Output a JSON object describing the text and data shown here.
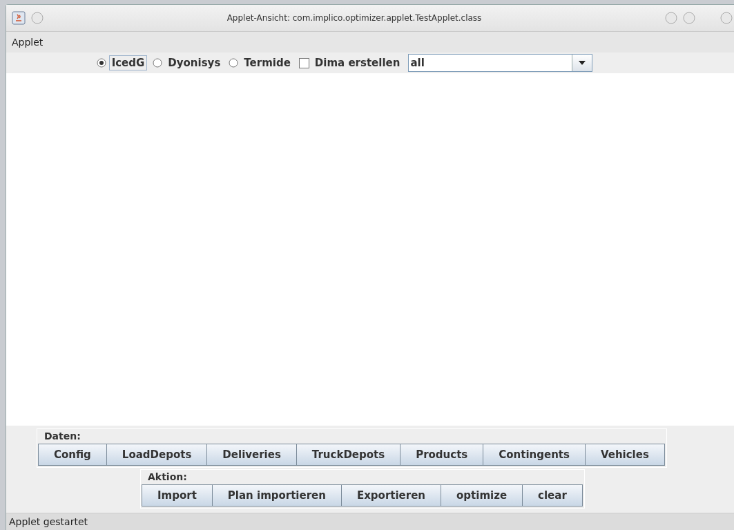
{
  "window": {
    "title": "Applet-Ansicht: com.implico.optimizer.applet.TestApplet.class"
  },
  "menu": [
    "Applet"
  ],
  "options": [
    {
      "kind": "radio",
      "label": "IcedG",
      "selected": true,
      "focused": true
    },
    {
      "kind": "radio",
      "label": "Dyonisys",
      "selected": false,
      "focused": false
    },
    {
      "kind": "radio",
      "label": "Termide",
      "selected": false,
      "focused": false
    },
    {
      "kind": "checkbox",
      "label": "Dima erstellen",
      "checked": false,
      "focused": false
    }
  ],
  "combo": {
    "value": "all"
  },
  "groups": [
    {
      "title": "Daten:",
      "buttons": [
        "Config",
        "LoadDepots",
        "Deliveries",
        "TruckDepots",
        "Products",
        "Contingents",
        "Vehicles"
      ]
    },
    {
      "title": "Aktion:",
      "buttons": [
        "Import",
        "Plan importieren",
        "Exportieren",
        "optimize",
        "clear"
      ]
    }
  ],
  "status_bar": "Applet gestartet"
}
